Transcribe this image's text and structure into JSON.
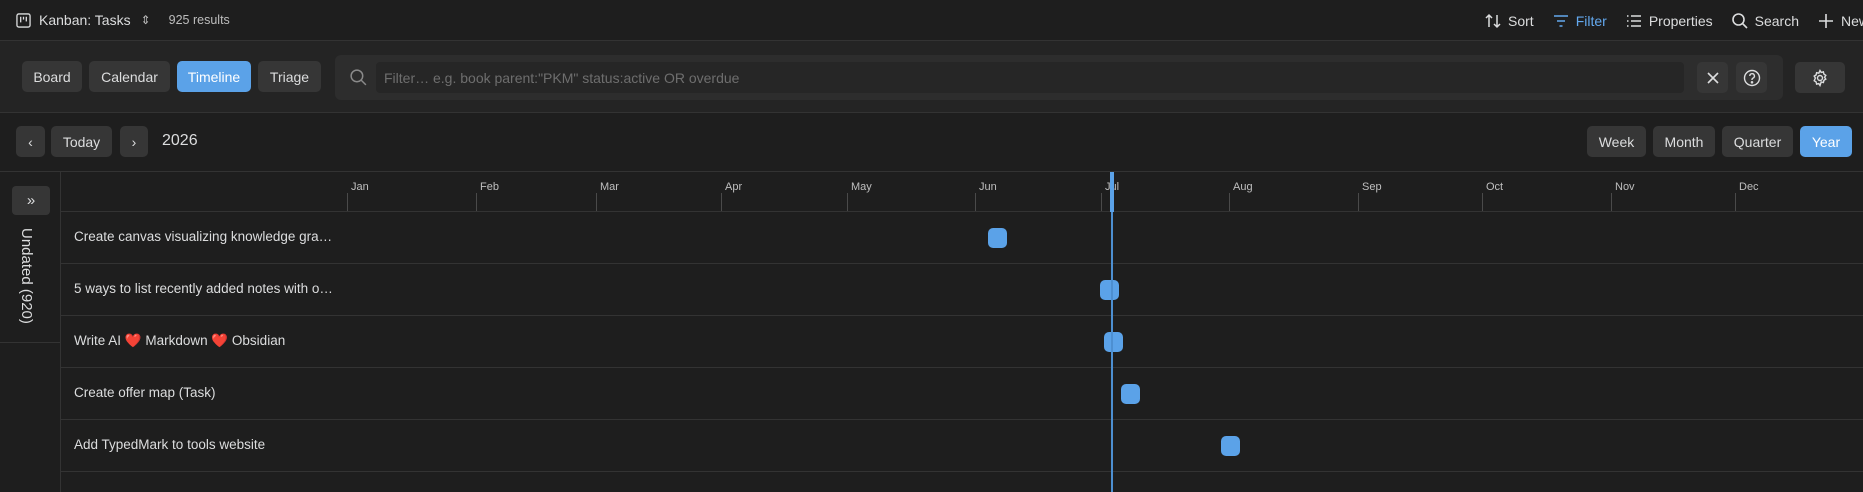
{
  "header": {
    "view_title": "Kanban: Tasks",
    "results": "925 results",
    "actions": [
      {
        "label": "Sort",
        "icon": "sort-icon",
        "active": false
      },
      {
        "label": "Filter",
        "icon": "filter-icon",
        "active": true
      },
      {
        "label": "Properties",
        "icon": "properties-icon",
        "active": false
      },
      {
        "label": "Search",
        "icon": "search-icon",
        "active": false
      },
      {
        "label": "New",
        "icon": "plus-icon",
        "active": false
      }
    ]
  },
  "views": {
    "tabs": [
      "Board",
      "Calendar",
      "Timeline",
      "Triage"
    ],
    "active": "Timeline"
  },
  "filter": {
    "placeholder": "Filter… e.g. book parent:\"PKM\" status:active OR overdue",
    "value": ""
  },
  "nav": {
    "prev": "‹",
    "today": "Today",
    "next": "›",
    "year": "2026",
    "zoom": [
      "Week",
      "Month",
      "Quarter",
      "Year"
    ],
    "zoom_active": "Year"
  },
  "sidebar": {
    "expand": "»",
    "undated": "Undated (920)"
  },
  "timeline": {
    "months": [
      "Jan",
      "Feb",
      "Mar",
      "Apr",
      "May",
      "Jun",
      "Jul",
      "Aug",
      "Sep",
      "Oct",
      "Nov",
      "Dec"
    ],
    "tasks": [
      {
        "title": "Create canvas visualizing knowledge gra…"
      },
      {
        "title": "5 ways to list recently added notes with o…"
      },
      {
        "title_parts": [
          "Write AI ",
          "❤️",
          " Markdown ",
          "❤️",
          " Obsidian"
        ]
      },
      {
        "title": "Create offer map (Task)"
      },
      {
        "title": "Add TypedMark to tools website"
      }
    ]
  },
  "colors": {
    "accent": "#5ba2e8",
    "background": "#1e1e1e",
    "button": "#363636"
  }
}
